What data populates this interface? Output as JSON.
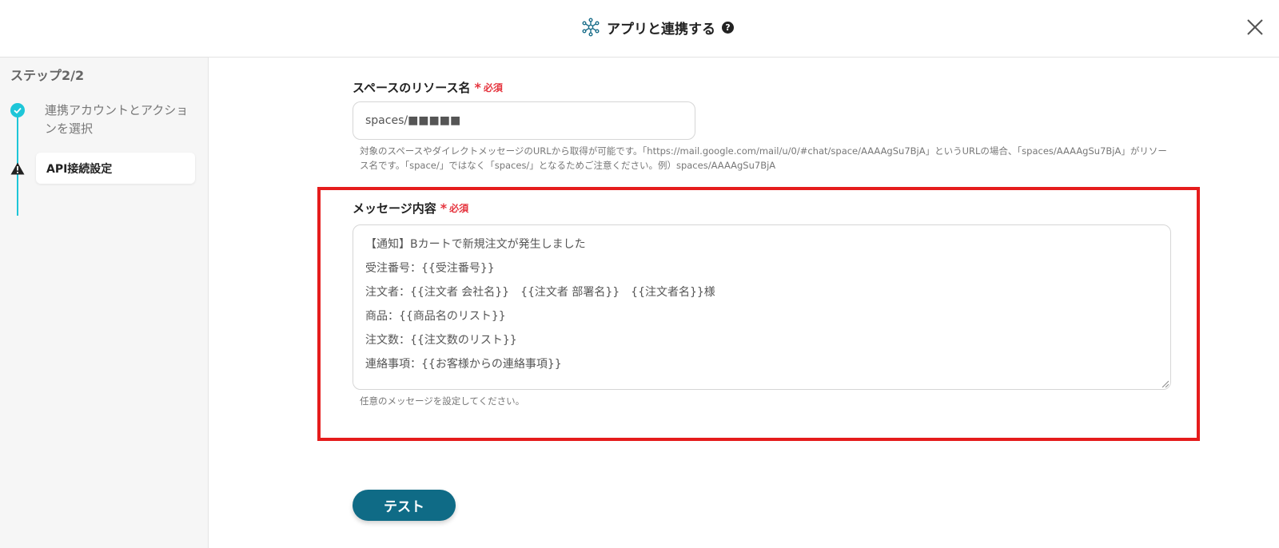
{
  "header": {
    "title": "アプリと連携する",
    "help_symbol": "?"
  },
  "sidebar": {
    "step_label": "ステップ2/2",
    "steps": [
      {
        "label": "連携アカウントとアクションを選択",
        "status": "done"
      },
      {
        "label": "API接続設定",
        "status": "warning"
      }
    ]
  },
  "form": {
    "resource_field": {
      "label": "スペースのリソース名",
      "required_label": "必須",
      "value": "spaces/■■■■■",
      "help_line1": "対象のスペースやダイレクトメッセージのURLから取得が可能です。「https://mail.google.com/mail/u/0/#chat/space/AAAAgSu7BjA」というURLの場合、「spaces/AAAAgSu7BjA」がリソー",
      "help_line2": "ス名です。「space/」ではなく「spaces/」となるためご注意ください。例）spaces/AAAAgSu7BjA"
    },
    "message_field": {
      "label": "メッセージ内容",
      "required_label": "必須",
      "lines": [
        "【通知】Bカートで新規注文が発生しました",
        "受注番号：{{受注番号}}",
        "注文者：{{注文者 会社名}}　{{注文者 部署名}}　{{注文者名}}様",
        "商品：{{商品名のリスト}}",
        "注文数：{{注文数のリスト}}",
        "連絡事項：{{お客様からの連絡事項}}"
      ],
      "help": "任意のメッセージを設定してください。"
    },
    "test_button": "テスト"
  },
  "colors": {
    "accent": "#1ec6d8",
    "button": "#0f6b86",
    "required": "#e5343e",
    "highlight": "#e51c1c"
  }
}
